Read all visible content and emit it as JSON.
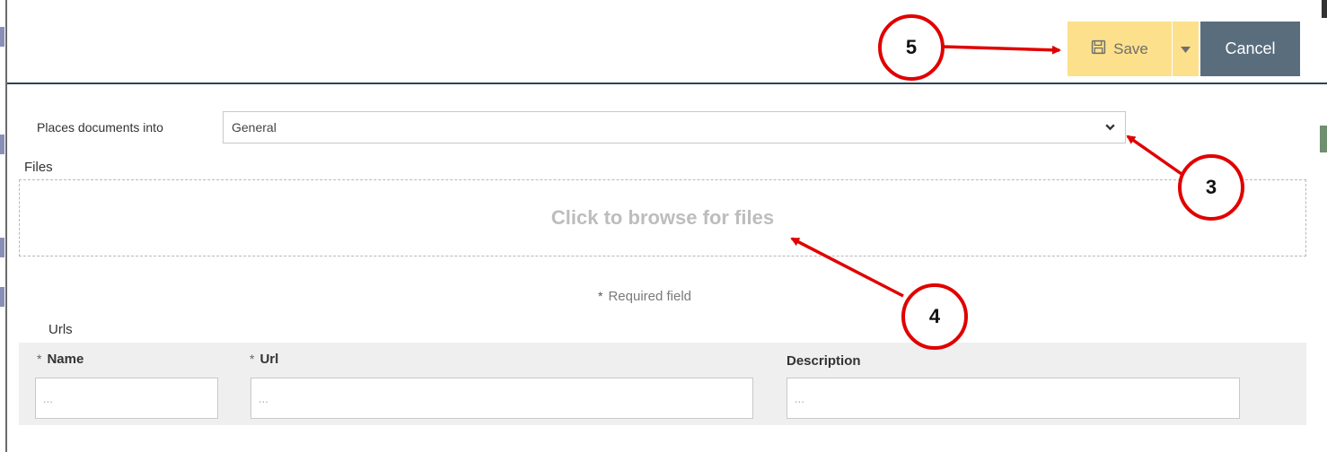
{
  "toolbar": {
    "save_label": "Save",
    "cancel_label": "Cancel"
  },
  "form": {
    "places_label": "Places documents into",
    "places_value": "General",
    "files_label": "Files",
    "dropzone_text": "Click to browse for files",
    "required_marker": "*",
    "required_note": "Required field"
  },
  "urls": {
    "section_label": "Urls",
    "columns": {
      "name": "Name",
      "url": "Url",
      "description": "Description"
    },
    "placeholder": "..."
  },
  "callouts": [
    "5",
    "3",
    "4"
  ],
  "colors": {
    "save_bg": "#fce08b",
    "cancel_bg": "#5a6d7c",
    "annotation_red": "#e00000",
    "header_rule": "#2d4257"
  },
  "icons": {
    "save": "floppy-disk-icon",
    "save_menu": "caret-down-icon",
    "select": "chevron-down-icon"
  }
}
